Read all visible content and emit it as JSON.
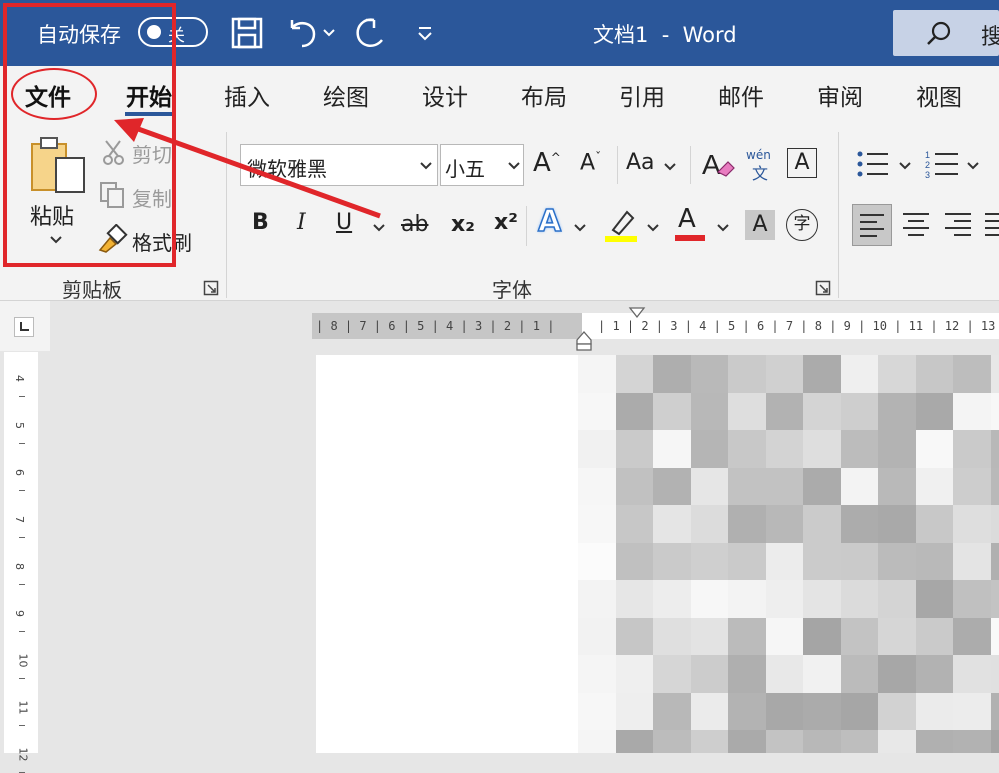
{
  "titlebar": {
    "autosave_label": "自动保存",
    "autosave_state": "关",
    "doc_title": "文档1  -  Word",
    "search_label": "搜"
  },
  "tabs": [
    "文件",
    "开始",
    "插入",
    "绘图",
    "设计",
    "布局",
    "引用",
    "邮件",
    "审阅",
    "视图"
  ],
  "clipboard": {
    "paste_label": "粘贴",
    "cut_label": "剪切",
    "copy_label": "复制",
    "format_painter_label": "格式刷",
    "group_label": "剪贴板"
  },
  "font": {
    "font_name": "微软雅黑",
    "font_size": "小五",
    "change_case": "Aa",
    "phonetic_top": "wén",
    "phonetic_bottom": "文",
    "border_char": "A",
    "bold": "B",
    "italic": "I",
    "underline": "U",
    "strike": "ab",
    "subscript": "x₂",
    "superscript": "x²",
    "enclose_char": "字",
    "group_label": "字体"
  },
  "ruler": {
    "top_left_marks": "| 8 | 7 | 6 | 5 | 4 | 3 | 2 | 1 |",
    "top_right_marks": "| 1 | 2 | 3 | 4 | 5 | 6 | 7 | 8 | 9 | 10 | 11 | 12 | 13",
    "left_marks": [
      "4",
      "5",
      "6",
      "7",
      "8",
      "9",
      "10",
      "11",
      "12"
    ]
  },
  "colors": {
    "title_bar": "#2b579a",
    "annotation": "#e0262a",
    "highlight_yellow": "#ffff00",
    "font_red": "#e0262a",
    "accent_blue": "#2b579a"
  }
}
